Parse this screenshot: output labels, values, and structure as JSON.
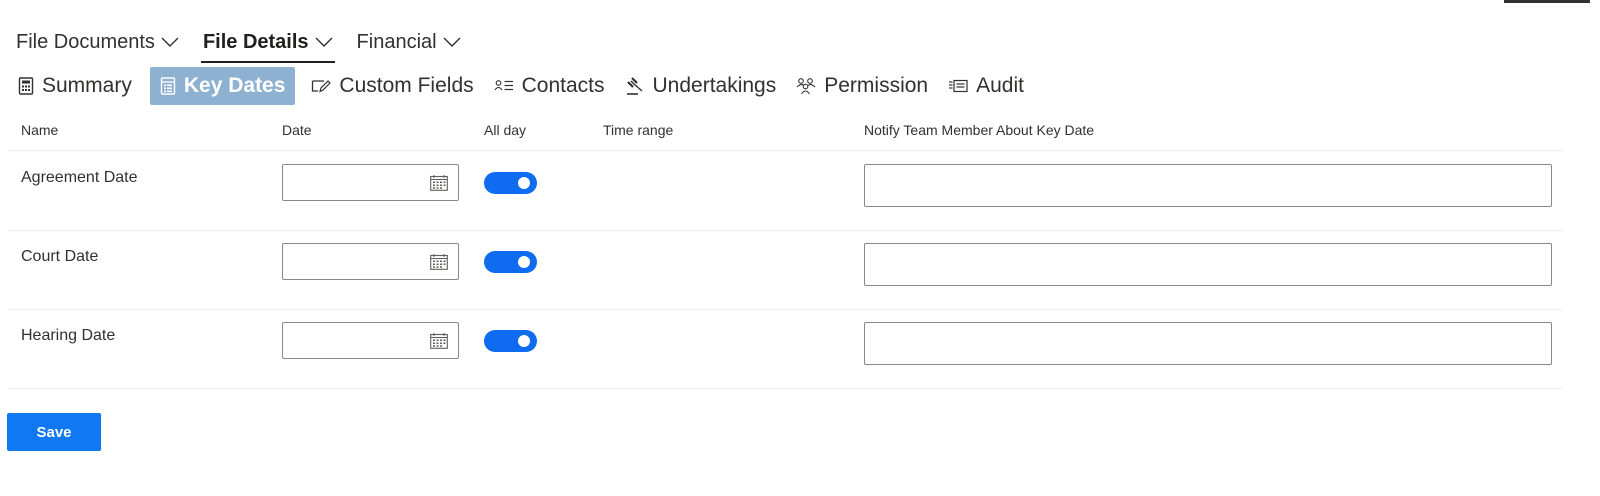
{
  "top_nav": [
    {
      "label": "File Documents",
      "active": false
    },
    {
      "label": "File Details",
      "active": true
    },
    {
      "label": "Financial",
      "active": false
    }
  ],
  "sub_tabs": [
    {
      "label": "Summary",
      "icon": "calculator-icon",
      "active": false
    },
    {
      "label": "Key Dates",
      "icon": "calendar-list-icon",
      "active": true
    },
    {
      "label": "Custom Fields",
      "icon": "edit-field-icon",
      "active": false
    },
    {
      "label": "Contacts",
      "icon": "contacts-list-icon",
      "active": false
    },
    {
      "label": "Undertakings",
      "icon": "gavel-icon",
      "active": false
    },
    {
      "label": "Permission",
      "icon": "people-icon",
      "active": false
    },
    {
      "label": "Audit",
      "icon": "audit-icon",
      "active": false
    }
  ],
  "table": {
    "headers": {
      "name": "Name",
      "date": "Date",
      "all_day": "All day",
      "time_range": "Time range",
      "notify": "Notify Team Member About Key Date"
    },
    "rows": [
      {
        "name": "Agreement Date",
        "date": "",
        "all_day": true,
        "notify": ""
      },
      {
        "name": "Court Date",
        "date": "",
        "all_day": true,
        "notify": ""
      },
      {
        "name": "Hearing Date",
        "date": "",
        "all_day": true,
        "notify": ""
      }
    ]
  },
  "save_label": "Save",
  "colors": {
    "active_tab_bg": "#8fb1d1",
    "toggle_on": "#0f6cf0",
    "primary_button": "#0f78f2"
  }
}
